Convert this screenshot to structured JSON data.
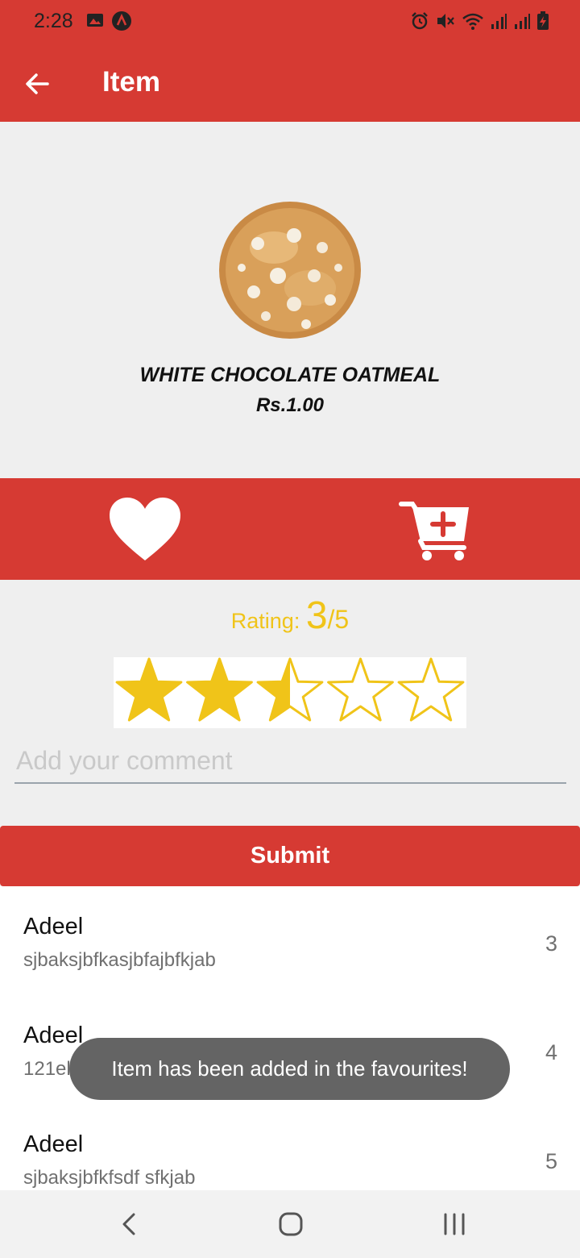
{
  "status_bar": {
    "time": "2:28",
    "left_icons": [
      "image-icon",
      "notification-a-icon"
    ],
    "right_icons": [
      "alarm-icon",
      "mute-icon",
      "wifi-icon",
      "signal-icon",
      "signal-icon",
      "battery-charging-icon"
    ]
  },
  "app_bar": {
    "title": "Item",
    "back_icon": "arrow-left-icon"
  },
  "item": {
    "name": "WHITE CHOCOLATE OATMEAL",
    "price": "Rs.1.00",
    "image": "cookie-image"
  },
  "actions": {
    "favourite_icon": "heart-icon",
    "cart_icon": "add-to-cart-icon"
  },
  "rating": {
    "label": "Rating: ",
    "value": "3",
    "max": "/5",
    "stars_filled": 2.5,
    "stars_total": 5
  },
  "comment": {
    "placeholder": "Add your comment",
    "value": ""
  },
  "submit_label": "Submit",
  "reviews": [
    {
      "name": "Adeel",
      "text": "sjbaksjbfkasjbfajbfkjab",
      "score": "3"
    },
    {
      "name": "Adeel",
      "text": "121elkwfkjh",
      "score": "4"
    },
    {
      "name": "Adeel",
      "text": "sjbaksjbfkfsdf sfkjab",
      "score": "5"
    }
  ],
  "toast": "Item has been added in the favourites!",
  "nav": {
    "icons": [
      "nav-back-icon",
      "nav-home-icon",
      "nav-recent-apps-icon"
    ]
  },
  "colors": {
    "primary": "#d63a33",
    "star": "#f0c419",
    "toast_bg": "#646464"
  }
}
